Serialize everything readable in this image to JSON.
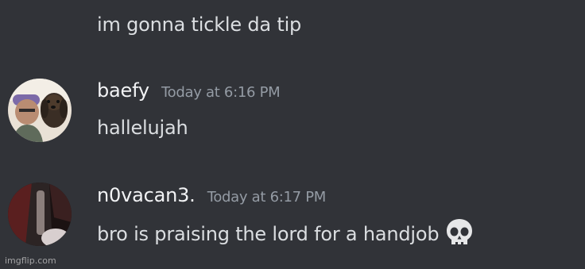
{
  "messages": [
    {
      "type": "continuation",
      "text": "im gonna tickle da tip"
    },
    {
      "type": "group",
      "username": "baefy",
      "timestamp": "Today at 6:16 PM",
      "text": "hallelujah",
      "avatar": "avatar-baefy"
    },
    {
      "type": "group",
      "username": "n0vacan3.",
      "timestamp": "Today at 6:17 PM",
      "text": "bro is praising the lord for a handjob",
      "emoji": "skull-emoji",
      "avatar": "avatar-n0vacan3"
    }
  ],
  "watermark": "imgflip.com",
  "colors": {
    "background": "#313338",
    "text": "#dbdee1",
    "username": "#f2f3f5",
    "timestamp": "#949ba4"
  }
}
